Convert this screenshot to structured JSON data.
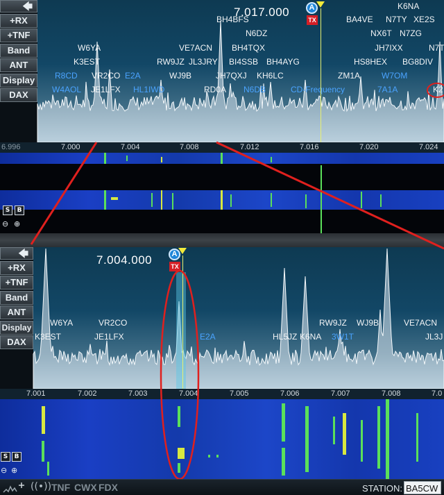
{
  "side_buttons": [
    "+RX",
    "+TNF",
    "Band",
    "ANT",
    "Display",
    "DAX"
  ],
  "top": {
    "frequency": "7.017.000",
    "vfo_badge": "A",
    "tx_badge": "TX",
    "scale_labels": [
      "6.996",
      "7.000",
      "7.004",
      "7.008",
      "7.012",
      "7.016",
      "7.020",
      "7.024"
    ],
    "spots_white": [
      "K6NA",
      "BH4BFS",
      "BA4VE",
      "N7TY",
      "XE2S",
      "N6DZ",
      "NX6T",
      "N7ZG",
      "W6YA",
      "BH4TQX",
      "JH7IXX",
      "N7T",
      "K3EST",
      "VE7ACN",
      "HS8HEX",
      "BG8DIV",
      "RW9JZ",
      "JL3JRY",
      "BI4SSB",
      "BH4AYG",
      "VR2CO",
      "WJ9B",
      "JH7QXJ",
      "KH6LC",
      "ZM1A",
      "JE1LFX",
      "RD0A",
      "K2"
    ],
    "spots_blue": [
      "R8CD",
      "E2A",
      "W7OM",
      "W4AOL",
      "HL1IWD",
      "N6DB",
      "CD-Frequency",
      "7A1A"
    ]
  },
  "bottom": {
    "frequency": "7.004.000",
    "vfo_badge": "A",
    "tx_badge": "TX",
    "scale_labels": [
      "7.001",
      "7.002",
      "7.003",
      "7.004",
      "7.005",
      "7.006",
      "7.007",
      "7.008",
      "7.0"
    ],
    "spots_white": [
      "W6YA",
      "VR2CO",
      "RW9JZ",
      "WJ9B",
      "VE7ACN",
      "K3EST",
      "JE1LFX",
      "HL5JZ",
      "K6NA",
      "JL3J"
    ],
    "spots_blue": [
      "E2A",
      "3W1T"
    ]
  },
  "waterfall_buttons": {
    "s": "S",
    "b": "B"
  },
  "status": {
    "modes": [
      "TNF",
      "CWX",
      "FDX"
    ],
    "station_label": "STATION:",
    "station_value": "BA5CW"
  },
  "colors": {
    "accent_blue": "#4aa3ff",
    "tx_red": "#d41f26",
    "vfo_yellow": "#f3ea3a",
    "annotation_red": "#e0201e"
  }
}
